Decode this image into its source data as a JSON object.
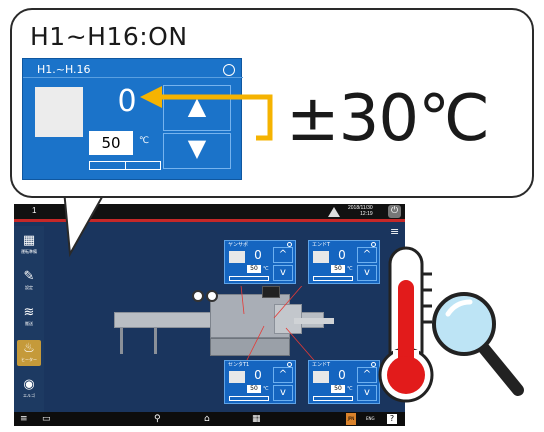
{
  "callout": {
    "title": "H1~H16:ON",
    "tolerance": "±30℃"
  },
  "zoom_panel": {
    "title": "H1.~H.16",
    "current_value": "0",
    "set_value": "50",
    "unit": "℃",
    "up_glyph": "▲",
    "down_glyph": "▼"
  },
  "screen": {
    "topbar": {
      "index": "1",
      "date": "2018/11/30",
      "time": "12:19",
      "power_icon": "⏻"
    },
    "menu_icon": "≡",
    "nav": [
      {
        "glyph": "▦",
        "label": "運転準備"
      },
      {
        "glyph": "✎",
        "label": "設定"
      },
      {
        "glyph": "≋",
        "label": "搬送"
      },
      {
        "glyph": "♨",
        "label": "ヒーター"
      },
      {
        "glyph": "◉",
        "label": "エルゴ"
      }
    ],
    "sensors": [
      {
        "label": "ヤンサポ",
        "current": "0",
        "set": "50",
        "unit": "℃",
        "up": "^",
        "down": "v"
      },
      {
        "label": "エンドT",
        "current": "0",
        "set": "50",
        "unit": "℃",
        "up": "^",
        "down": "v"
      },
      {
        "label": "センタT1",
        "current": "0",
        "set": "50",
        "unit": "℃",
        "up": "^",
        "down": "v"
      },
      {
        "label": "エンドT",
        "current": "0",
        "set": "50",
        "unit": "℃",
        "up": "^",
        "down": "v"
      }
    ],
    "bottombar": {
      "menu": "≡",
      "monitor": "▭",
      "tool": "⚲",
      "home": "⌂",
      "grid": "▦",
      "lang": "JPN",
      "eng": "ENG",
      "help": "?"
    }
  },
  "colors": {
    "panel_blue": "#1b73c9",
    "screen_bg": "#1a355e",
    "bracket_yellow": "#f5b301",
    "alert_red": "#c62828",
    "thermo_red": "#e21b1b"
  }
}
